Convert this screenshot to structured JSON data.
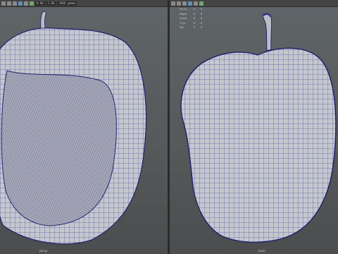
{
  "left_viewport": {
    "toolbar": {
      "gamma_field": "sRGB gamma",
      "exposure_value": "0.00",
      "gamma_value": "1.00"
    },
    "camera_label": "persp"
  },
  "right_viewport": {
    "hud": [
      {
        "label": "Verts",
        "a": "0",
        "b": "0"
      },
      {
        "label": "Edges",
        "a": "0",
        "b": "0"
      },
      {
        "label": "Faces",
        "a": "0",
        "b": "0"
      },
      {
        "label": "Tris",
        "a": "0",
        "b": "0"
      },
      {
        "label": "UVs",
        "a": "0",
        "b": "0"
      }
    ],
    "camera_label": "back"
  },
  "colors": {
    "mesh_fill": "#bfc2c9",
    "wire": "#2d2f8a",
    "viewport_bg": "#585b5d"
  }
}
